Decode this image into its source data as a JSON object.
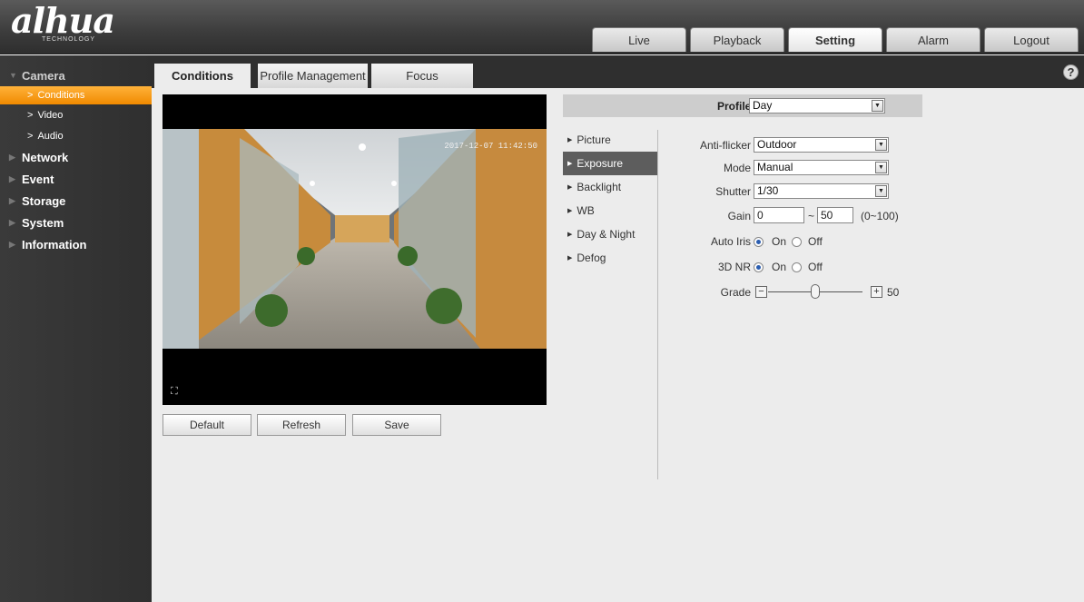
{
  "brand": {
    "logo": "alhua",
    "logo_sub": "TECHNOLOGY"
  },
  "topnav": {
    "live": "Live",
    "playback": "Playback",
    "setting": "Setting",
    "alarm": "Alarm",
    "logout": "Logout",
    "active": "Setting"
  },
  "sidebar": {
    "camera": "Camera",
    "conditions": "Conditions",
    "video": "Video",
    "audio": "Audio",
    "network": "Network",
    "event": "Event",
    "storage": "Storage",
    "system": "System",
    "information": "Information"
  },
  "tabs": {
    "conditions": "Conditions",
    "profile": "Profile Management",
    "focus": "Focus"
  },
  "help": "?",
  "video": {
    "timestamp": "2017-12-07 11:42:50"
  },
  "buttons": {
    "default": "Default",
    "refresh": "Refresh",
    "save": "Save"
  },
  "profile": {
    "label": "Profile",
    "value": "Day"
  },
  "submenu": {
    "picture": "Picture",
    "exposure": "Exposure",
    "backlight": "Backlight",
    "wb": "WB",
    "daynight": "Day & Night",
    "defog": "Defog"
  },
  "form": {
    "antiflicker_label": "Anti-flicker",
    "antiflicker_value": "Outdoor",
    "mode_label": "Mode",
    "mode_value": "Manual",
    "shutter_label": "Shutter",
    "shutter_value": "1/30",
    "gain_label": "Gain",
    "gain_min": "0",
    "gain_sep": "~",
    "gain_max": "50",
    "gain_range": "(0~100)",
    "autoiris_label": "Auto Iris",
    "on": "On",
    "off": "Off",
    "nr_label": "3D NR",
    "grade_label": "Grade",
    "grade_value": "50",
    "grade_fraction": 0.5
  },
  "colors": {
    "accent": "#f59a1a",
    "active_menu": "#5d5d5d",
    "header": "#3c3c3c"
  }
}
